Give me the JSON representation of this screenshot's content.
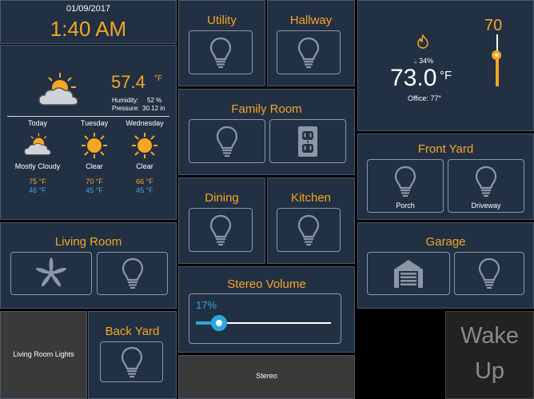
{
  "clock": {
    "date": "01/09/2017",
    "time": "1:40 AM"
  },
  "weather": {
    "temp": "57.4",
    "unit": "°F",
    "humidity_label": "Humidity:",
    "humidity_value": "52 %",
    "pressure_label": "Pressure:",
    "pressure_value": "30.12 in",
    "forecast": [
      {
        "day": "Today",
        "cond": "Mostly Cloudy",
        "high": "75 °F",
        "low": "46 °F",
        "icon": "partly-cloudy-icon"
      },
      {
        "day": "Tuesday",
        "cond": "Clear",
        "high": "70 °F",
        "low": "45 °F",
        "icon": "sun-icon"
      },
      {
        "day": "Wednesday",
        "cond": "Clear",
        "high": "66 °F",
        "low": "45 °F",
        "icon": "sun-icon"
      }
    ]
  },
  "tiles": {
    "utility": "Utility",
    "hallway": "Hallway",
    "family_room": "Family Room",
    "dining": "Dining",
    "kitchen": "Kitchen",
    "living_room": "Living Room",
    "back_yard": "Back Yard",
    "front_yard": "Front Yard",
    "porch": "Porch",
    "driveway": "Driveway",
    "garage": "Garage",
    "stereo_volume": "Stereo Volume",
    "living_room_lights": "Living Room Lights",
    "stereo": "Stereo",
    "wake_up_line1": "Wake",
    "wake_up_line2": "Up"
  },
  "volume": {
    "value_text": "17%",
    "level": 0.17
  },
  "thermostat": {
    "humidity": "34%",
    "temp": "73.0",
    "unit": "°F",
    "office": "Office: 77°",
    "setpoint": "70",
    "setpoint_level": 0.6
  },
  "colors": {
    "accent": "#f5a623",
    "tile": "#223044",
    "blue": "#29a8e0"
  }
}
